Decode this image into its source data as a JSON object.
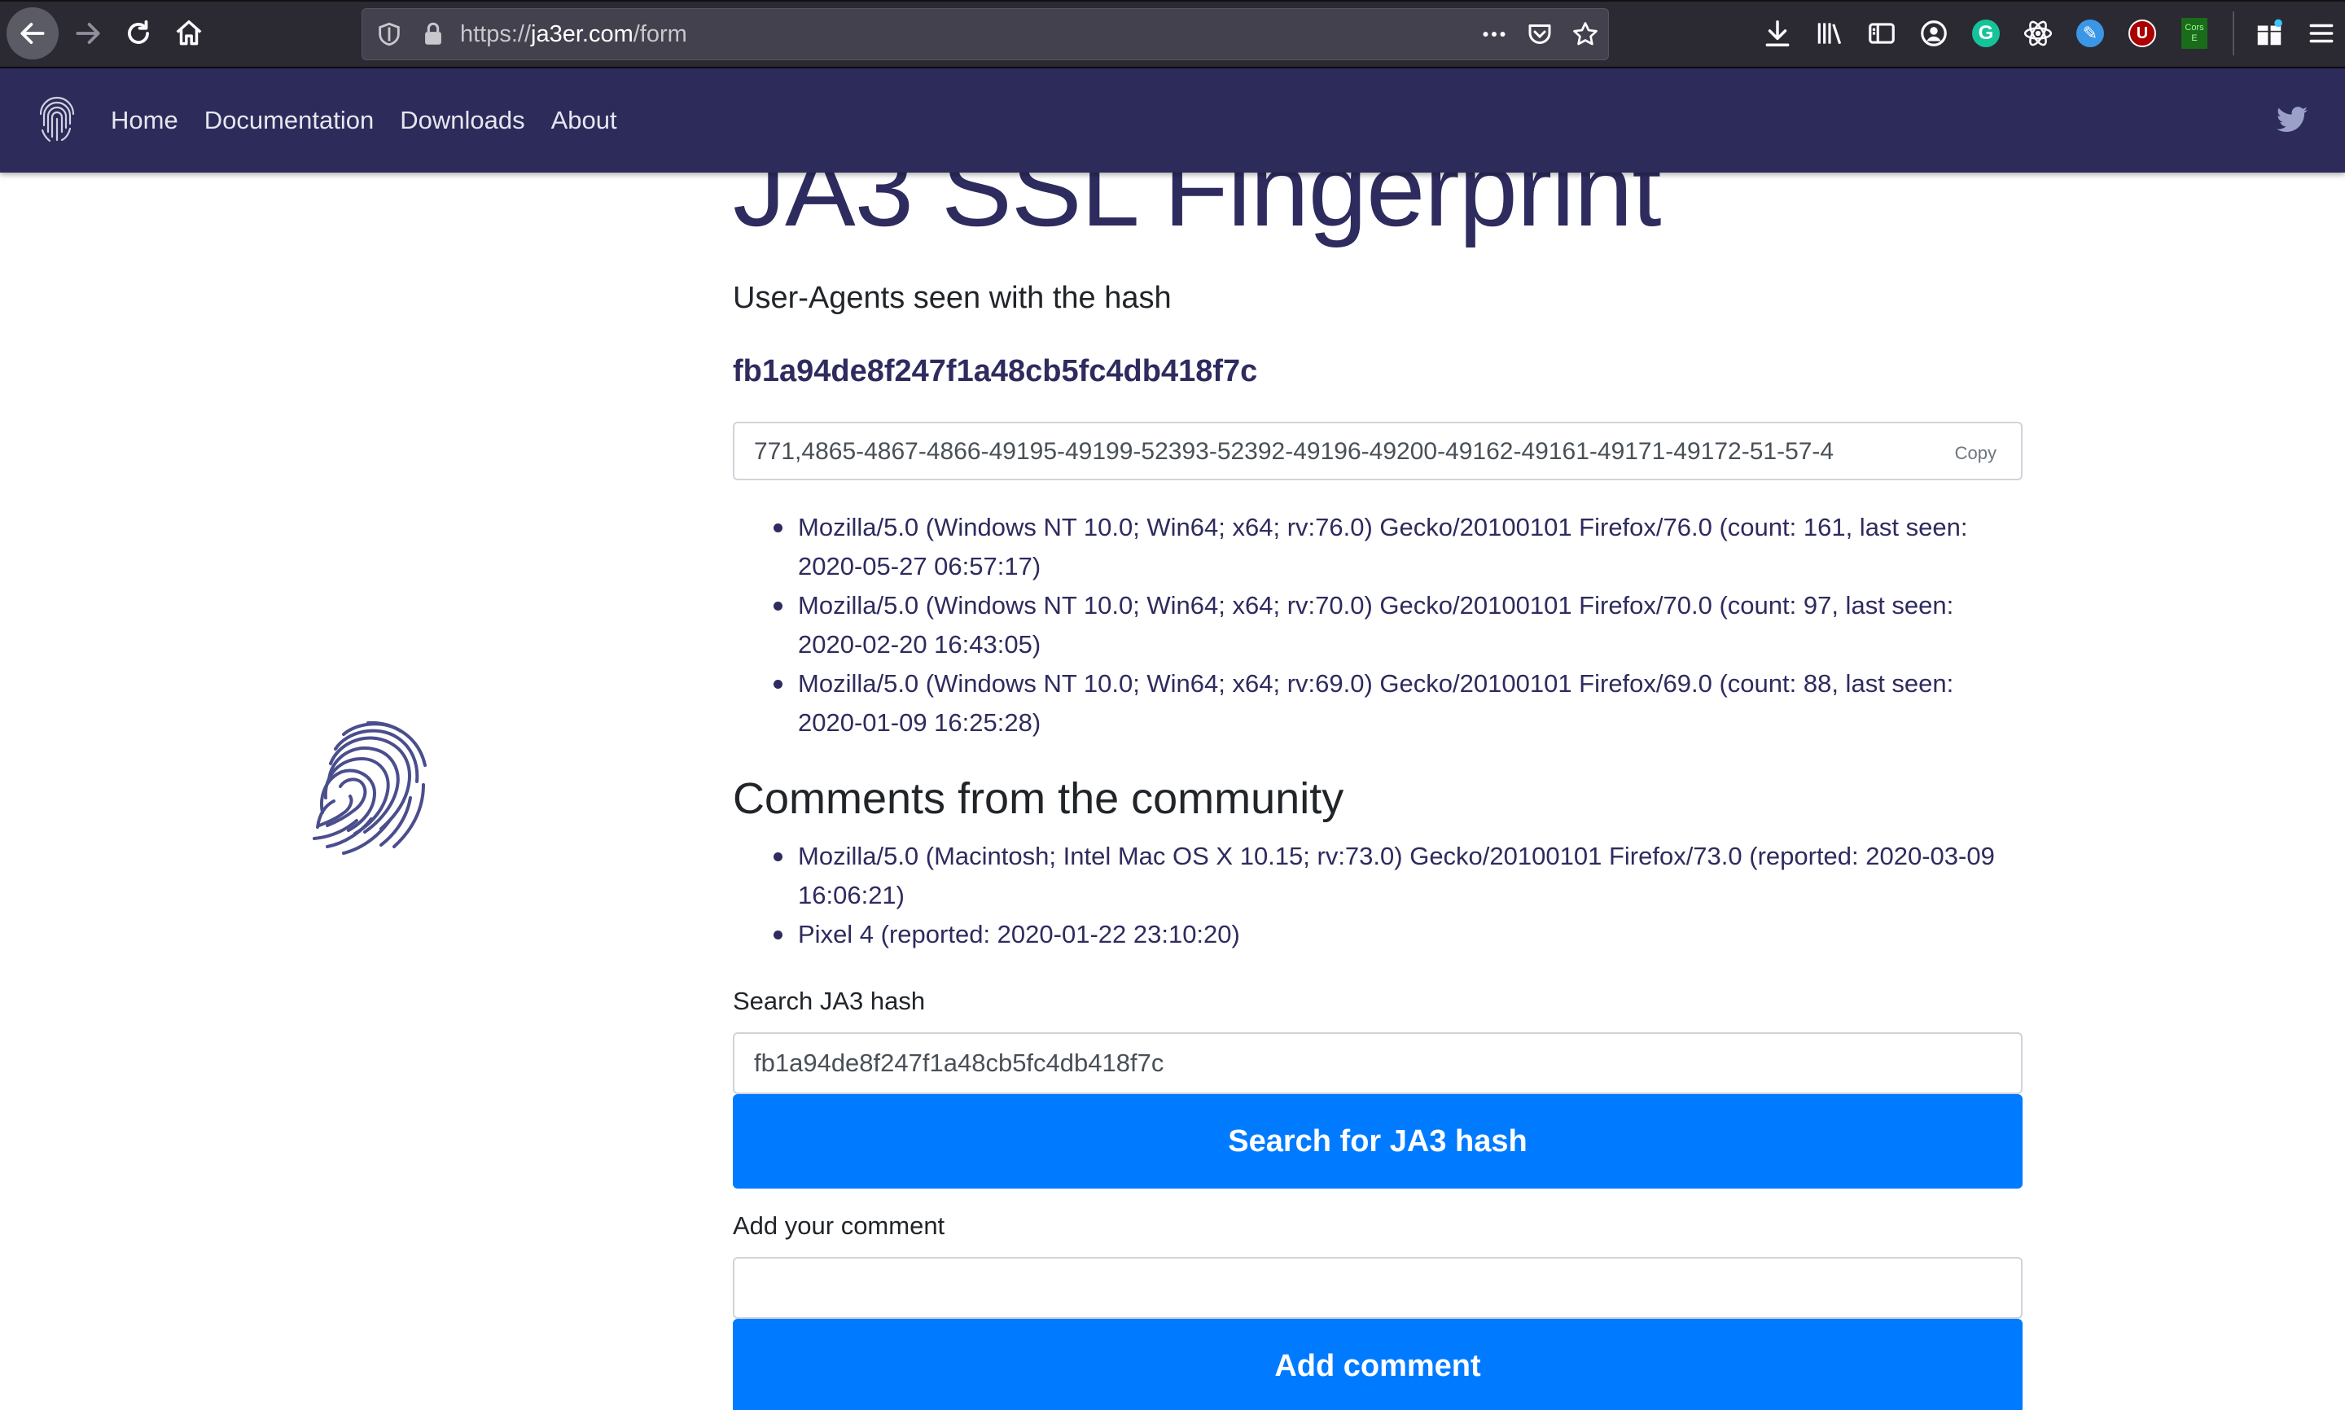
{
  "browser": {
    "url_prefix": "https://",
    "url_host": "ja3er.com",
    "url_path": "/form",
    "cors_label": "Cors E"
  },
  "navbar": {
    "links": [
      "Home",
      "Documentation",
      "Downloads",
      "About"
    ]
  },
  "page": {
    "title": "JA3 SSL Fingerprint",
    "subtitle": "User-Agents seen with the hash",
    "hash": "fb1a94de8f247f1a48cb5fc4db418f7c",
    "ja3_string": "771,4865-4867-4866-49195-49199-52393-52392-49196-49200-49162-49161-49171-49172-51-57-4",
    "copy_label": "Copy",
    "user_agents": [
      "Mozilla/5.0 (Windows NT 10.0; Win64; x64; rv:76.0) Gecko/20100101 Firefox/76.0 (count: 161, last seen: 2020-05-27 06:57:17)",
      "Mozilla/5.0 (Windows NT 10.0; Win64; x64; rv:70.0) Gecko/20100101 Firefox/70.0 (count: 97, last seen: 2020-02-20 16:43:05)",
      "Mozilla/5.0 (Windows NT 10.0; Win64; x64; rv:69.0) Gecko/20100101 Firefox/69.0 (count: 88, last seen: 2020-01-09 16:25:28)"
    ],
    "comments_heading": "Comments from the community",
    "comments": [
      "Mozilla/5.0 (Macintosh; Intel Mac OS X 10.15; rv:73.0) Gecko/20100101 Firefox/73.0 (reported: 2020-03-09 16:06:21)",
      "Pixel 4 (reported: 2020-01-22 23:10:20)"
    ],
    "search_label": "Search JA3 hash",
    "search_value": "fb1a94de8f247f1a48cb5fc4db418f7c",
    "search_button": "Search for JA3 hash",
    "comment_label": "Add your comment",
    "comment_value": "",
    "comment_button": "Add comment"
  },
  "colors": {
    "navbar_bg": "#2c2b5a",
    "accent_text": "#2e2b5e",
    "button_primary": "#007bff"
  }
}
